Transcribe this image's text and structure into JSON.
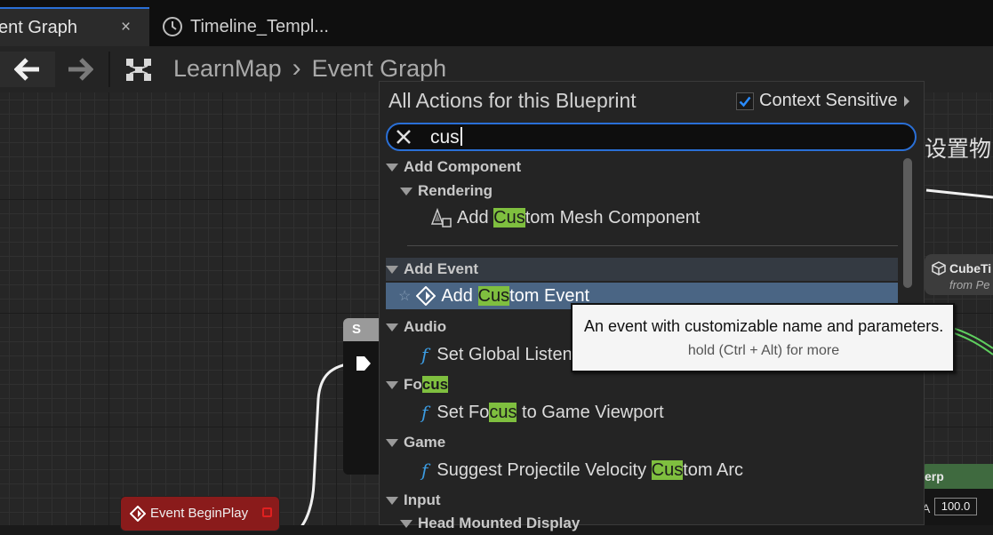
{
  "tabs": [
    {
      "label": "ent Graph",
      "close": "×"
    },
    {
      "label": "Timeline_Templ..."
    }
  ],
  "breadcrumb": {
    "root": "LearnMap",
    "separator": "›",
    "current": "Event Graph"
  },
  "graph": {
    "event_begin_play": "Event BeginPlay",
    "right_node_title": "CubeTi",
    "right_node_sub": "from Pe",
    "right_top_text": "设置物",
    "interp_label": "erp",
    "a_label": "A",
    "a_value": "100.0",
    "mid_node_letter": "S"
  },
  "popup": {
    "title": "All Actions for this Blueprint",
    "context_sensitive_label": "Context Sensitive",
    "context_sensitive_checked": true,
    "search": {
      "value": "cus"
    },
    "rows": [
      {
        "kind": "category",
        "pre": "Add Component",
        "hl": "",
        "post": ""
      },
      {
        "kind": "subcategory",
        "pre": "Rendering",
        "hl": "",
        "post": ""
      },
      {
        "kind": "item",
        "icon": "mesh-component-icon",
        "pre": "Add ",
        "hl": "Cus",
        "post": "tom Mesh Component"
      },
      {
        "kind": "category",
        "pre": "Add Event",
        "hl": "",
        "post": ""
      },
      {
        "kind": "item",
        "icon": "event-icon",
        "pre": "Add ",
        "hl": "Cus",
        "post": "tom Event",
        "selected": true
      },
      {
        "kind": "category",
        "pre": "Audio",
        "hl": "",
        "post": ""
      },
      {
        "kind": "item",
        "icon": "function-icon",
        "pre": "Set Global Listener Focus",
        "hl": "",
        "post": ""
      },
      {
        "kind": "category",
        "pre": "Fo",
        "hl": "cus",
        "post": ""
      },
      {
        "kind": "item",
        "icon": "function-icon",
        "pre": "Set Fo",
        "hl": "cus",
        "post": " to Game Viewport"
      },
      {
        "kind": "category",
        "pre": "Game",
        "hl": "",
        "post": ""
      },
      {
        "kind": "item",
        "icon": "function-icon",
        "pre": "Suggest Projectile Velocity ",
        "hl": "Cus",
        "post": "tom Arc"
      },
      {
        "kind": "category",
        "pre": "Input",
        "hl": "",
        "post": ""
      },
      {
        "kind": "subcategory",
        "pre": "Head Mounted Display",
        "hl": "",
        "post": ""
      }
    ]
  },
  "tooltip": {
    "line1": "An event with customizable name and parameters.",
    "line2": "hold (Ctrl + Alt) for more"
  },
  "colors": {
    "accent": "#2a6fd6",
    "highlight": "#7fbf3f",
    "function": "#3c9be0",
    "event_node": "#8a1b1b"
  }
}
